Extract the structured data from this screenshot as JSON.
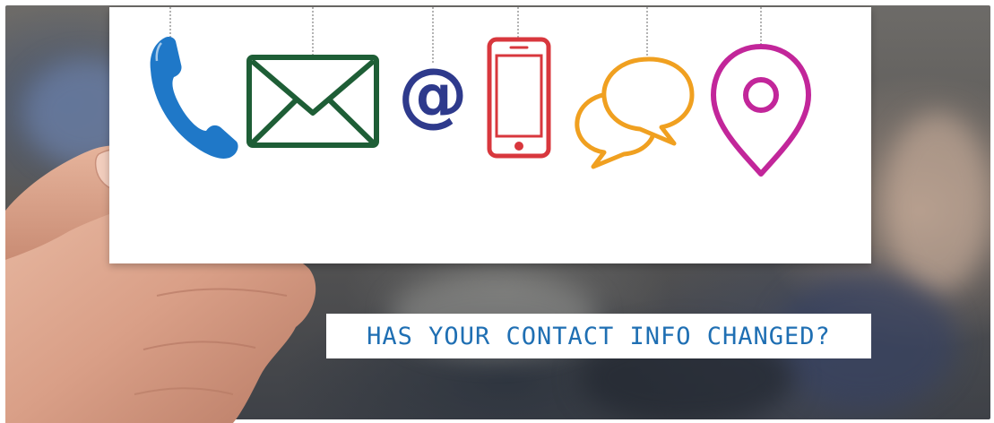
{
  "caption": {
    "text": "HAS YOUR CONTACT INFO CHANGED?"
  },
  "card_icons": [
    {
      "name": "phone-icon",
      "color": "#1f78c8"
    },
    {
      "name": "envelope-icon",
      "color": "#1e5e36"
    },
    {
      "name": "at-sign-icon",
      "color": "#2e3a8c",
      "glyph": "@"
    },
    {
      "name": "mobile-phone-icon",
      "color": "#d8373d"
    },
    {
      "name": "chat-bubbles-icon",
      "color": "#f0a020"
    },
    {
      "name": "map-pin-icon",
      "color": "#c2269a"
    }
  ],
  "colors": {
    "caption_text": "#1f6fb3",
    "card": "#ffffff",
    "background": "#5a5856"
  }
}
